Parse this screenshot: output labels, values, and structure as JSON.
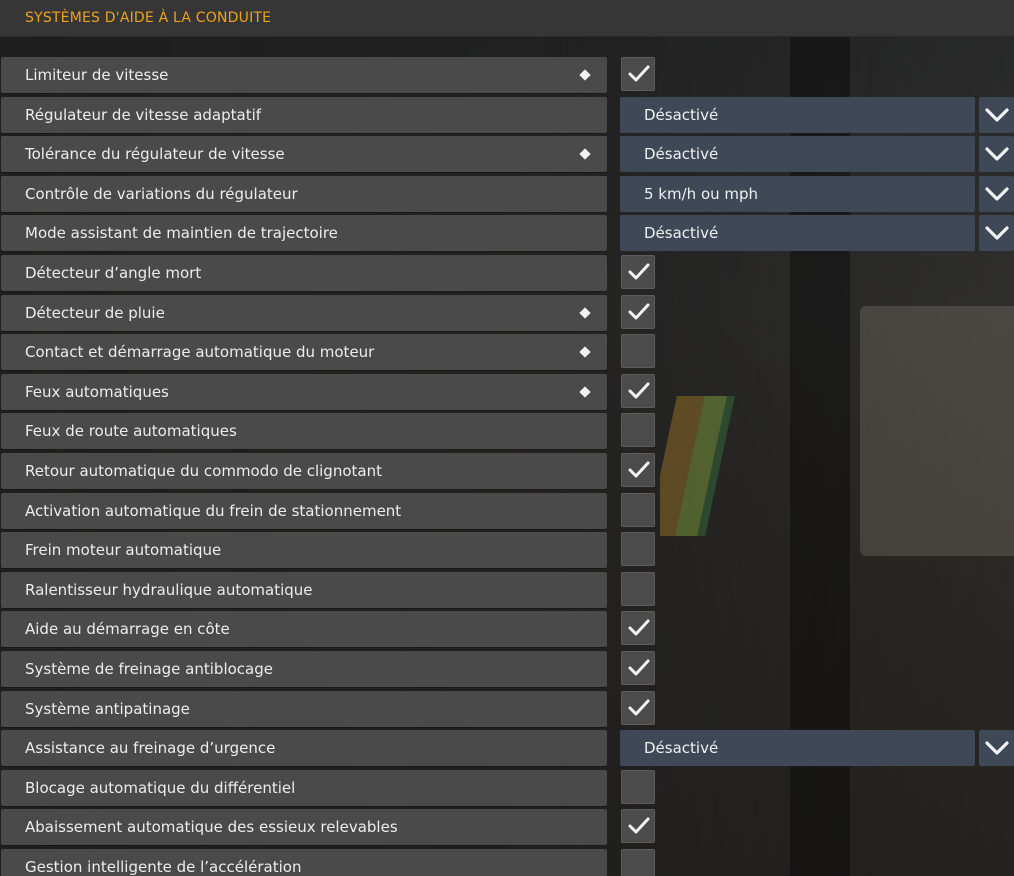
{
  "header": {
    "title": "SYSTÈMES D'AIDE À LA CONDUITE"
  },
  "colors": {
    "accent": "#f0a020",
    "dropdown": "#3e4856",
    "row": "#4a4a4a"
  },
  "rows": [
    {
      "label": "Limiteur de vitesse",
      "diamond": true,
      "type": "checkbox",
      "checked": true
    },
    {
      "label": "Régulateur de vitesse adaptatif",
      "diamond": false,
      "type": "select",
      "value": "Désactivé"
    },
    {
      "label": "Tolérance du régulateur de vitesse",
      "diamond": true,
      "type": "select",
      "value": "Désactivé"
    },
    {
      "label": "Contrôle de variations du régulateur",
      "diamond": false,
      "type": "select",
      "value": "5 km/h ou mph"
    },
    {
      "label": "Mode assistant de maintien de trajectoire",
      "diamond": false,
      "type": "select",
      "value": "Désactivé"
    },
    {
      "label": "Détecteur d’angle mort",
      "diamond": false,
      "type": "checkbox",
      "checked": true
    },
    {
      "label": "Détecteur de pluie",
      "diamond": true,
      "type": "checkbox",
      "checked": true
    },
    {
      "label": "Contact et démarrage automatique du moteur",
      "diamond": true,
      "type": "checkbox",
      "checked": false
    },
    {
      "label": "Feux automatiques",
      "diamond": true,
      "type": "checkbox",
      "checked": true
    },
    {
      "label": "Feux de route automatiques",
      "diamond": false,
      "type": "checkbox",
      "checked": false
    },
    {
      "label": "Retour automatique du commodo de clignotant",
      "diamond": false,
      "type": "checkbox",
      "checked": true
    },
    {
      "label": "Activation automatique du frein de stationnement",
      "diamond": false,
      "type": "checkbox",
      "checked": false
    },
    {
      "label": "Frein moteur automatique",
      "diamond": false,
      "type": "checkbox",
      "checked": false
    },
    {
      "label": "Ralentisseur hydraulique automatique",
      "diamond": false,
      "type": "checkbox",
      "checked": false
    },
    {
      "label": "Aide au démarrage en côte",
      "diamond": false,
      "type": "checkbox",
      "checked": true
    },
    {
      "label": "Système de freinage antiblocage",
      "diamond": false,
      "type": "checkbox",
      "checked": true
    },
    {
      "label": "Système antipatinage",
      "diamond": false,
      "type": "checkbox",
      "checked": true
    },
    {
      "label": "Assistance au freinage d’urgence",
      "diamond": false,
      "type": "select",
      "value": "Désactivé"
    },
    {
      "label": "Blocage automatique du différentiel",
      "diamond": false,
      "type": "checkbox",
      "checked": false
    },
    {
      "label": "Abaissement automatique des essieux relevables",
      "diamond": false,
      "type": "checkbox",
      "checked": true
    },
    {
      "label": "Gestion intelligente de l’accélération",
      "diamond": false,
      "type": "checkbox",
      "checked": false
    }
  ]
}
